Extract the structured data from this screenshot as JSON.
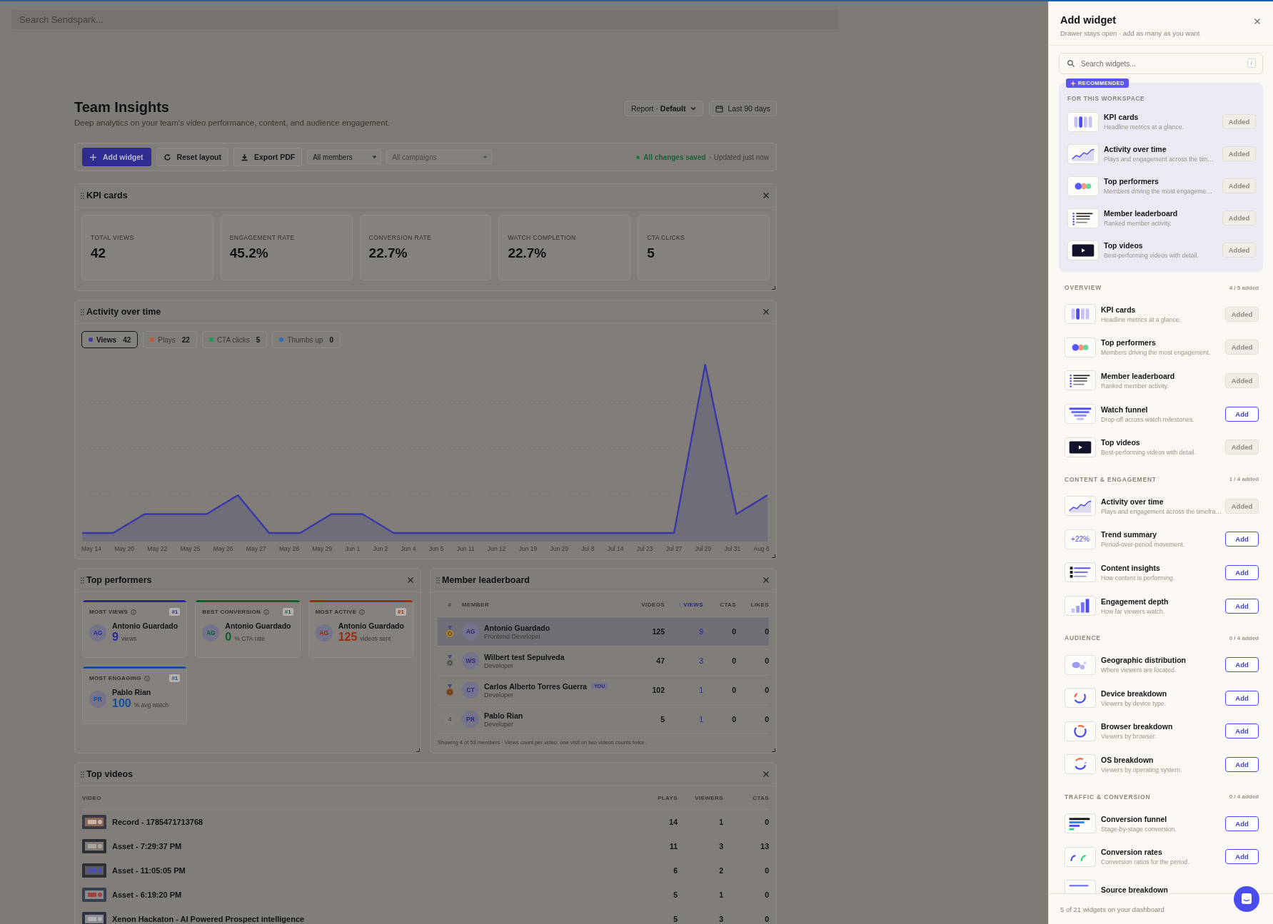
{
  "search": {
    "placeholder": "Search Sendspark..."
  },
  "header": {
    "title": "Team Insights",
    "subtitle": "Deep analytics on your team's video performance, content, and audience engagement.",
    "report": "Report · **Default**",
    "date_range": "Last 90 days"
  },
  "toolbar": {
    "buttons": [
      {
        "kind": "add",
        "label": "Add widget"
      },
      {
        "kind": "reset",
        "label": "Reset layout"
      },
      {
        "kind": "export",
        "label": "Export PDF"
      }
    ],
    "selects": [
      {
        "value": "All members"
      },
      {
        "placeholder": "All campaigns"
      }
    ],
    "status": "All changes saved",
    "updated": "· Updated just now"
  },
  "widgets": [
    {
      "kind": "kpi",
      "title": "KPI cards",
      "cards": [
        {
          "label": "TOTAL VIEWS",
          "value": "42"
        },
        {
          "label": "ENGAGEMENT RATE",
          "value": "45.2%"
        },
        {
          "label": "CONVERSION RATE",
          "value": "22.7%"
        },
        {
          "label": "WATCH COMPLETION",
          "value": "22.7%"
        },
        {
          "label": "CTA CLICKS",
          "value": "5"
        }
      ]
    },
    {
      "kind": "activity",
      "title": "Activity over time",
      "series": [
        {
          "label": "Views",
          "count": "42",
          "color": "#3a37a8",
          "selected": true
        },
        {
          "label": "Plays",
          "count": "22",
          "color": "#c9553a",
          "selected": false
        },
        {
          "label": "CTA clicks",
          "count": "5",
          "color": "#1f9a5e",
          "selected": false
        },
        {
          "label": "Thumbs up",
          "count": "0",
          "color": "#2a6ab8",
          "selected": false
        }
      ],
      "x_labels": [
        "May 14",
        "May 20",
        "May 22",
        "May 25",
        "May 26",
        "May 27",
        "May 28",
        "May 29",
        "Jun 1",
        "Jun 2",
        "Jun 4",
        "Jun 5",
        "Jun 11",
        "Jun 12",
        "Jun 19",
        "Jun 29",
        "Jul 8",
        "Jul 14",
        "Jul 23",
        "Jul 27",
        "Jul 29",
        "Jul 31",
        "Aug 6"
      ]
    },
    {
      "kind": "performers",
      "title": "Top performers",
      "cards": [
        {
          "label": "MOST VIEWS",
          "rank": "#1",
          "initials": "AG",
          "name": "Antonio Guardado",
          "value": "9",
          "unit": "views",
          "color": "#2a26a0"
        },
        {
          "label": "BEST CONVERSION",
          "rank": "#1",
          "initials": "AG",
          "name": "Antonio Guardado",
          "value": "0",
          "unit": "% CTA rate",
          "color": "#0a5e2e"
        },
        {
          "label": "MOST ACTIVE",
          "rank": "#1",
          "initials": "AG",
          "name": "Antonio Guardado",
          "value": "125",
          "unit": "videos sent",
          "color": "#9a2c0c"
        },
        {
          "label": "MOST ENGAGING",
          "rank": "#1",
          "initials": "PR",
          "name": "Pablo Rian",
          "value": "100",
          "unit": "% avg watch",
          "color": "#154f9a"
        }
      ]
    },
    {
      "kind": "leaderboard",
      "title": "Member leaderboard",
      "columns": [
        {
          "label": "#",
          "sorted": false
        },
        {
          "label": "MEMBER",
          "sorted": false
        },
        {
          "label": "VIDEOS",
          "sorted": false
        },
        {
          "label": "↓ VIEWS",
          "sorted": true
        },
        {
          "label": "CTAS",
          "sorted": false
        },
        {
          "label": "LIKES",
          "sorted": false
        }
      ],
      "rows": [
        {
          "kind": "gold",
          "initials": "AG",
          "name": "Antonio Guardado",
          "role": "Frontend Developer",
          "videos": "125",
          "views": "9",
          "ctas": "0",
          "likes": "0",
          "selected": true
        },
        {
          "kind": "silver",
          "initials": "WS",
          "name": "Wilbert test Sepulveda",
          "role": "Developer",
          "videos": "47",
          "views": "3",
          "ctas": "0",
          "likes": "0",
          "selected": false
        },
        {
          "kind": "bronze",
          "initials": "CT",
          "name": "Carlos Alberto Torres Guerra",
          "badge": "YOU",
          "role": "Developer",
          "videos": "102",
          "views": "1",
          "ctas": "0",
          "likes": "0",
          "selected": false
        },
        {
          "kind": "number",
          "rank": "4",
          "initials": "PR",
          "name": "Pablo Rian",
          "role": "Developer",
          "videos": "5",
          "views": "1",
          "ctas": "0",
          "likes": "0",
          "selected": false
        }
      ],
      "footnote": "Showing 4 of 53 members · Views count per video: one visit on two videos counts twice."
    },
    {
      "kind": "videos",
      "title": "Top videos",
      "columns": [
        "VIDEO",
        "PLAYS",
        "VIEWERS",
        "CTAS"
      ],
      "rows": [
        {
          "title": "Record - 1785471713768",
          "plays": "14",
          "viewers": "1",
          "ctas": "0"
        },
        {
          "title": "Asset - 7:29:37 PM",
          "plays": "11",
          "viewers": "3",
          "ctas": "13"
        },
        {
          "title": "Asset - 11:05:05 PM",
          "plays": "6",
          "viewers": "2",
          "ctas": "0"
        },
        {
          "title": "Asset - 6:19:20 PM",
          "plays": "5",
          "viewers": "1",
          "ctas": "0"
        },
        {
          "title": "Xenon Hackaton - AI Powered Prospect intelligence",
          "plays": "5",
          "viewers": "3",
          "ctas": "0"
        }
      ]
    }
  ],
  "drawer": {
    "title": "Add widget",
    "subtitle": "Drawer stays open · add as many as you want",
    "search": {
      "placeholder": "Search widgets...",
      "shortcut": "/"
    },
    "recommended": {
      "badge": "RECOMMENDED",
      "heading": "FOR THIS WORKSPACE",
      "items": [
        {
          "kind": "kpi",
          "title": "KPI cards",
          "desc": "Headline metrics at a glance.",
          "button": "Added",
          "added": true
        },
        {
          "kind": "activity",
          "title": "Activity over time",
          "desc": "Plays and engagement across the tim…",
          "button": "Added",
          "added": true
        },
        {
          "kind": "performers",
          "title": "Top performers",
          "desc": "Members driving the most engageme…",
          "button": "Added",
          "added": true
        },
        {
          "kind": "leaderboard",
          "title": "Member leaderboard",
          "desc": "Ranked member activity.",
          "button": "Added",
          "added": true
        },
        {
          "kind": "videos",
          "title": "Top videos",
          "desc": "Best-performing videos with detail.",
          "button": "Added",
          "added": true
        }
      ]
    },
    "sections": [
      {
        "title": "OVERVIEW",
        "count": "4 / 5 added",
        "items": [
          {
            "kind": "kpi",
            "title": "KPI cards",
            "desc": "Headline metrics at a glance.",
            "button": "Added",
            "added": true
          },
          {
            "kind": "performers",
            "title": "Top performers",
            "desc": "Members driving the most engagement.",
            "button": "Added",
            "added": true
          },
          {
            "kind": "leaderboard",
            "title": "Member leaderboard",
            "desc": "Ranked member activity.",
            "button": "Added",
            "added": true
          },
          {
            "kind": "funnel",
            "title": "Watch funnel",
            "desc": "Drop-off across watch milestones.",
            "button": "Add",
            "added": false
          },
          {
            "kind": "videos",
            "title": "Top videos",
            "desc": "Best-performing videos with detail.",
            "button": "Added",
            "added": true
          }
        ]
      },
      {
        "title": "CONTENT & ENGAGEMENT",
        "count": "1 / 4 added",
        "items": [
          {
            "kind": "activity",
            "title": "Activity over time",
            "desc": "Plays and engagement across the timefra…",
            "button": "Added",
            "added": true
          },
          {
            "kind": "trend",
            "icon_text": "+22%",
            "title": "Trend summary",
            "desc": "Period-over-period movement.",
            "button": "Add",
            "added": false
          },
          {
            "kind": "content",
            "title": "Content insights",
            "desc": "How content is performing.",
            "button": "Add",
            "added": false
          },
          {
            "kind": "depth",
            "title": "Engagement depth",
            "desc": "How far viewers watch.",
            "button": "Add",
            "added": false
          }
        ]
      },
      {
        "title": "AUDIENCE",
        "count": "0 / 4 added",
        "items": [
          {
            "kind": "geo",
            "title": "Geographic distribution",
            "desc": "Where viewers are located.",
            "button": "Add",
            "added": false
          },
          {
            "kind": "device",
            "title": "Device breakdown",
            "desc": "Viewers by device type.",
            "button": "Add",
            "added": false
          },
          {
            "kind": "browser",
            "title": "Browser breakdown",
            "desc": "Viewers by browser.",
            "button": "Add",
            "added": false
          },
          {
            "kind": "os",
            "title": "OS breakdown",
            "desc": "Viewers by operating system.",
            "button": "Add",
            "added": false
          }
        ]
      },
      {
        "title": "TRAFFIC & CONVERSION",
        "count": "0 / 4 added",
        "items": [
          {
            "kind": "conv_funnel",
            "title": "Conversion funnel",
            "desc": "Stage-by-stage conversion.",
            "button": "Add",
            "added": false
          },
          {
            "kind": "conv_rates",
            "title": "Conversion rates",
            "desc": "Conversion ratios for the period.",
            "button": "Add",
            "added": false
          },
          {
            "kind": "source",
            "title": "Source breakdown"
          }
        ]
      }
    ],
    "footer": "5 of 21 widgets on your dashboard"
  }
}
